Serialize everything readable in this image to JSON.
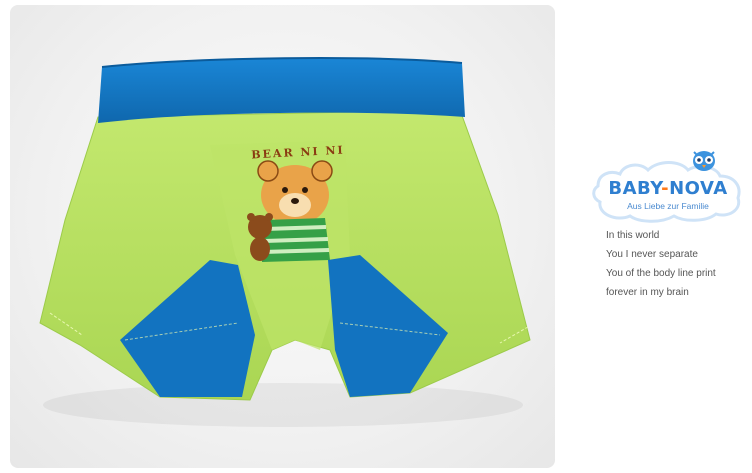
{
  "photo": {
    "subject": "kids boxer briefs",
    "print_text": "BEAR NI NI"
  },
  "brand": {
    "name_part1": "BABY",
    "separator": "-",
    "name_part2": "NOVA",
    "tagline": "Aus Liebe zur Familie",
    "mascot_icon": "owl-icon"
  },
  "text_lines": [
    "In this world",
    "You I never separate",
    "You of the body line print",
    "forever in my brain"
  ],
  "colors": {
    "fabric_green": "#b7e060",
    "waistband_blue": "#1277c4",
    "brand_blue": "#2f7fd0",
    "brand_orange": "#ff7a1a"
  }
}
